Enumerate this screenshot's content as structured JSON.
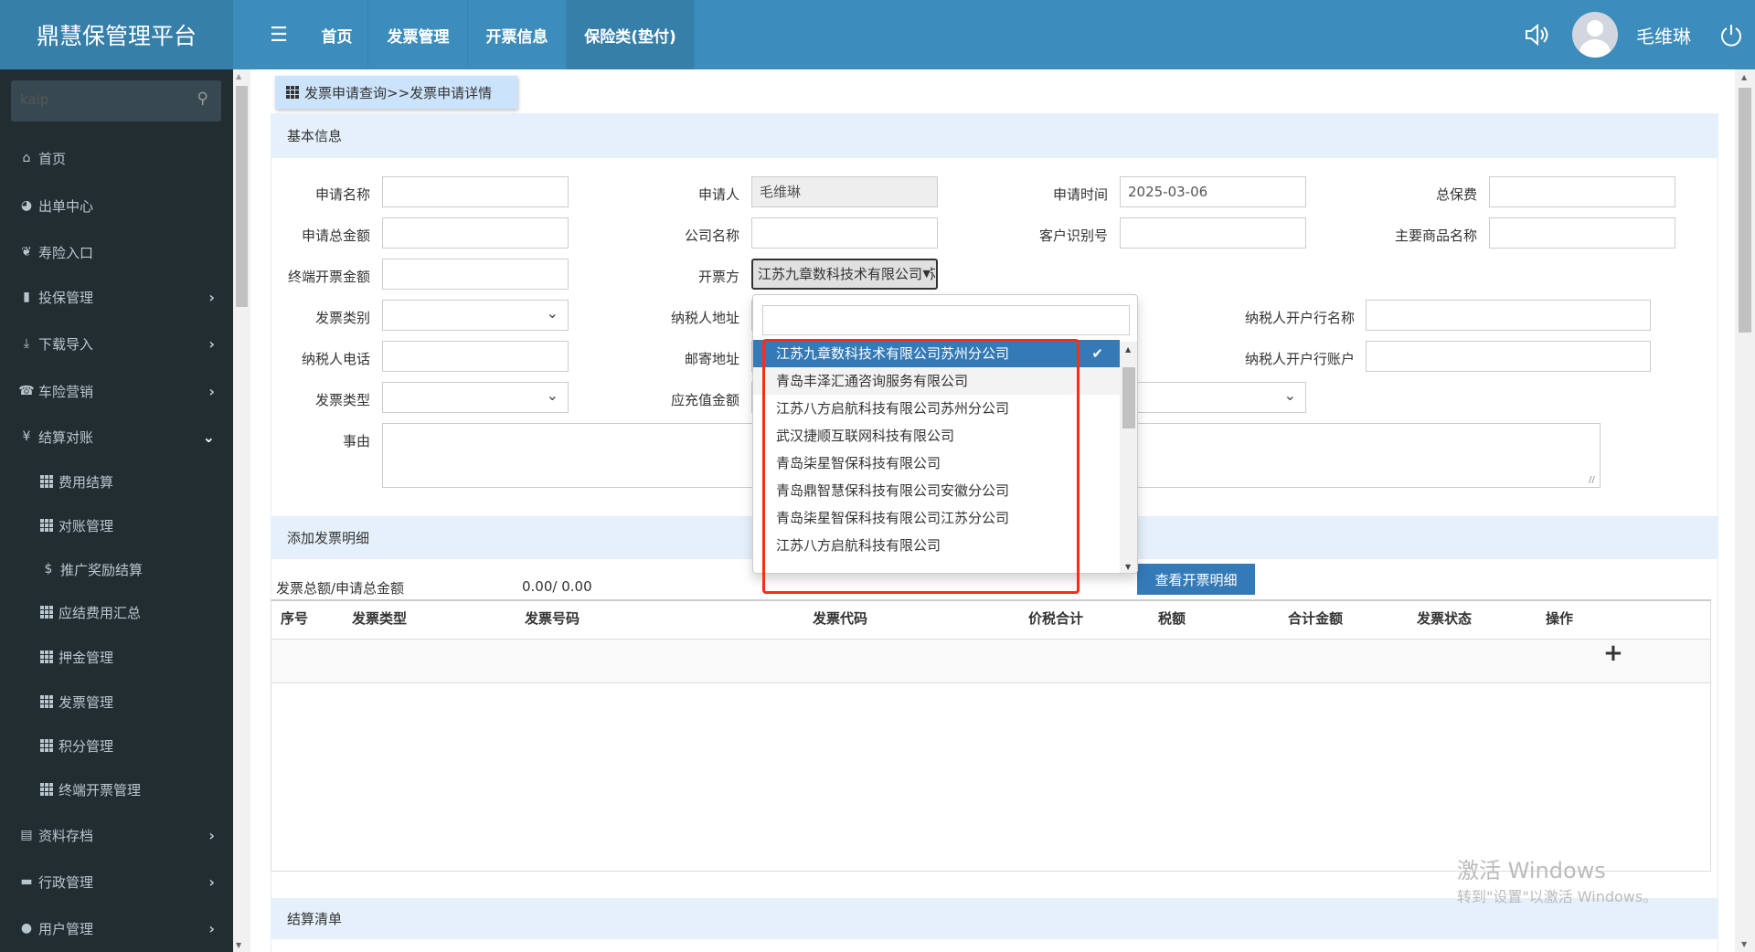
{
  "header": {
    "app_title": "鼎慧保管理平台",
    "nav": [
      "首页",
      "发票管理",
      "开票信息",
      "保险类(垫付)"
    ],
    "user_name": "毛维琳"
  },
  "sidebar": {
    "search_value": "kaip",
    "items": [
      {
        "label": "首页",
        "icon": "home-icon"
      },
      {
        "label": "出单中心",
        "icon": "globe-icon"
      },
      {
        "label": "寿险入口",
        "icon": "leaf-icon"
      },
      {
        "label": "投保管理",
        "icon": "file-icon"
      },
      {
        "label": "下载导入",
        "icon": "download-icon"
      },
      {
        "label": "车险营销",
        "icon": "phone-icon"
      },
      {
        "label": "结算对账",
        "icon": "yen-icon"
      },
      {
        "label": "费用结算",
        "icon": "grid-icon"
      },
      {
        "label": "对账管理",
        "icon": "grid-icon"
      },
      {
        "label": "推广奖励结算",
        "icon": "dollar-icon"
      },
      {
        "label": "应结费用汇总",
        "icon": "grid-icon"
      },
      {
        "label": "押金管理",
        "icon": "grid-icon"
      },
      {
        "label": "发票管理",
        "icon": "grid-icon"
      },
      {
        "label": "积分管理",
        "icon": "grid-icon"
      },
      {
        "label": "终端开票管理",
        "icon": "grid-icon"
      },
      {
        "label": "资料存档",
        "icon": "list-icon"
      },
      {
        "label": "行政管理",
        "icon": "folder-icon"
      },
      {
        "label": "用户管理",
        "icon": "user-icon"
      }
    ]
  },
  "breadcrumb": "发票申请查询>>发票申请详情",
  "sections": {
    "basic": "基本信息",
    "detail": "添加发票明细",
    "settlement": "结算清单"
  },
  "form": {
    "apply_name": "申请名称",
    "applicant": "申请人",
    "applicant_value": "毛维琳",
    "apply_time": "申请时间",
    "apply_time_value": "2025-03-06",
    "total_premium": "总保费",
    "apply_total": "申请总金额",
    "company_name": "公司名称",
    "customer_id": "客户识别号",
    "main_goods": "主要商品名称",
    "terminal_amount": "终端开票金额",
    "issuer": "开票方",
    "issuer_value": "江苏九章数科技术有限公司苏州分公司",
    "invoice_category": "发票类别",
    "taxpayer_address": "纳税人地址",
    "taxpayer_bank_name": "纳税人开户行名称",
    "taxpayer_phone": "纳税人电话",
    "mail_address": "邮寄地址",
    "taxpayer_bank_account": "纳税人开户行账户",
    "invoice_type": "发票类型",
    "recharge_amount": "应充值金额",
    "reason": "事由"
  },
  "dropdown": {
    "options": [
      "江苏九章数科技术有限公司苏州分公司",
      "青岛丰泽汇通咨询服务有限公司",
      "江苏八方启航科技有限公司苏州分公司",
      "武汉捷顺互联网科技有限公司",
      "青岛柒星智保科技有限公司",
      "青岛鼎智慧保科技有限公司安徽分公司",
      "青岛柒星智保科技有限公司江苏分公司",
      "江苏八方启航科技有限公司"
    ]
  },
  "summary": {
    "label": "发票总额/申请总金额",
    "value": "0.00/ 0.00",
    "view_button": "查看开票明细"
  },
  "table": {
    "columns": [
      "序号",
      "发票类型",
      "发票号码",
      "发票代码",
      "价税合计",
      "税额",
      "合计金额",
      "发票状态",
      "操作"
    ],
    "add_symbol": "+"
  },
  "watermark": {
    "line1": "激活 Windows",
    "line2": "转到\"设置\"以激活 Windows。"
  }
}
